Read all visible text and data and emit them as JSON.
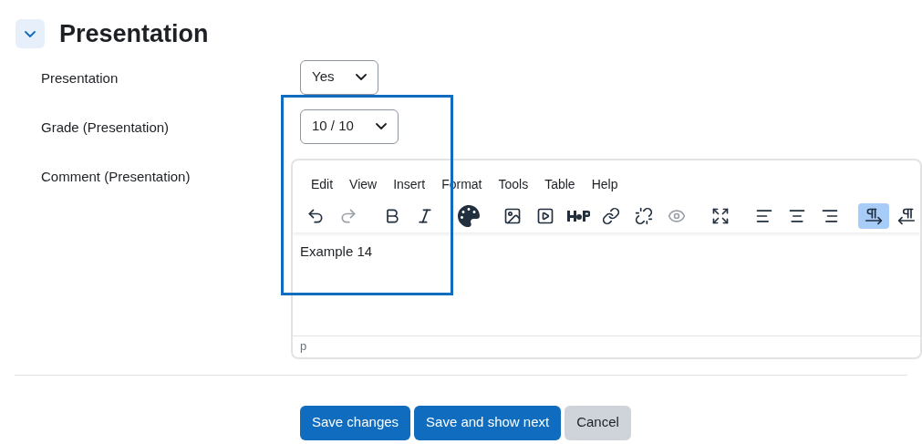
{
  "section": {
    "title": "Presentation",
    "expanded": true
  },
  "fields": [
    {
      "kind": "select",
      "label": "Presentation",
      "value": "Yes"
    },
    {
      "kind": "select",
      "label": "Grade (Presentation)",
      "value": "10 / 10"
    },
    {
      "kind": "editor",
      "label": "Comment (Presentation)"
    }
  ],
  "editor": {
    "menu": [
      "Edit",
      "View",
      "Insert",
      "Format",
      "Tools",
      "Table",
      "Help"
    ],
    "toolbar": [
      {
        "buttons": [
          {
            "kind": "undo",
            "disabled": false,
            "selected": false
          },
          {
            "kind": "redo",
            "disabled": true,
            "selected": false
          }
        ]
      },
      {
        "buttons": [
          {
            "kind": "bold",
            "disabled": false,
            "selected": false
          },
          {
            "kind": "italic",
            "disabled": false,
            "selected": false
          }
        ]
      },
      {
        "buttons": [
          {
            "kind": "palette",
            "disabled": false,
            "selected": false
          }
        ]
      },
      {
        "buttons": [
          {
            "kind": "image",
            "disabled": false,
            "selected": false
          },
          {
            "kind": "media",
            "disabled": false,
            "selected": false
          },
          {
            "kind": "h5p",
            "disabled": false,
            "selected": false
          },
          {
            "kind": "link",
            "disabled": false,
            "selected": false
          },
          {
            "kind": "unlink",
            "disabled": false,
            "selected": false
          },
          {
            "kind": "preview",
            "disabled": true,
            "selected": false
          }
        ]
      },
      {
        "buttons": [
          {
            "kind": "fullscreen",
            "disabled": false,
            "selected": false
          }
        ]
      },
      {
        "buttons": [
          {
            "kind": "align-left",
            "disabled": false,
            "selected": false
          },
          {
            "kind": "align-center",
            "disabled": false,
            "selected": false
          },
          {
            "kind": "align-right",
            "disabled": false,
            "selected": false
          }
        ]
      },
      {
        "buttons": [
          {
            "kind": "ltr",
            "disabled": false,
            "selected": true
          },
          {
            "kind": "rtl",
            "disabled": false,
            "selected": false
          }
        ]
      }
    ],
    "content": "Example 14",
    "path": "p"
  },
  "highlight": true,
  "buttons": [
    {
      "kind": "primary",
      "label": "Save changes"
    },
    {
      "kind": "primary",
      "label": "Save and show next"
    },
    {
      "kind": "secondary",
      "label": "Cancel"
    }
  ]
}
